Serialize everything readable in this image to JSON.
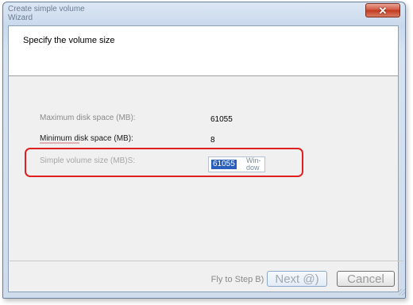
{
  "window": {
    "title": "Create simple volume Wizard",
    "close_icon": "close-icon",
    "close_symbol": "✕"
  },
  "header": {
    "title": "Specify the volume size",
    "subtitle": "· · · · · ·  · · ·"
  },
  "fields": {
    "max_label": "Maximum disk space (MB):",
    "max_value": "61055",
    "min_label": "Minimum disk space (MB):",
    "min_value": "8",
    "size_label": "Simple volume size (MB)S:",
    "size_value": "61055",
    "size_suffix": "Win-dow"
  },
  "buttons": {
    "back": "Fly to Step B)",
    "next": "Next @)",
    "cancel": "Cancel"
  },
  "colors": {
    "highlight": "#e02020",
    "selection": "#2a5ebd"
  }
}
